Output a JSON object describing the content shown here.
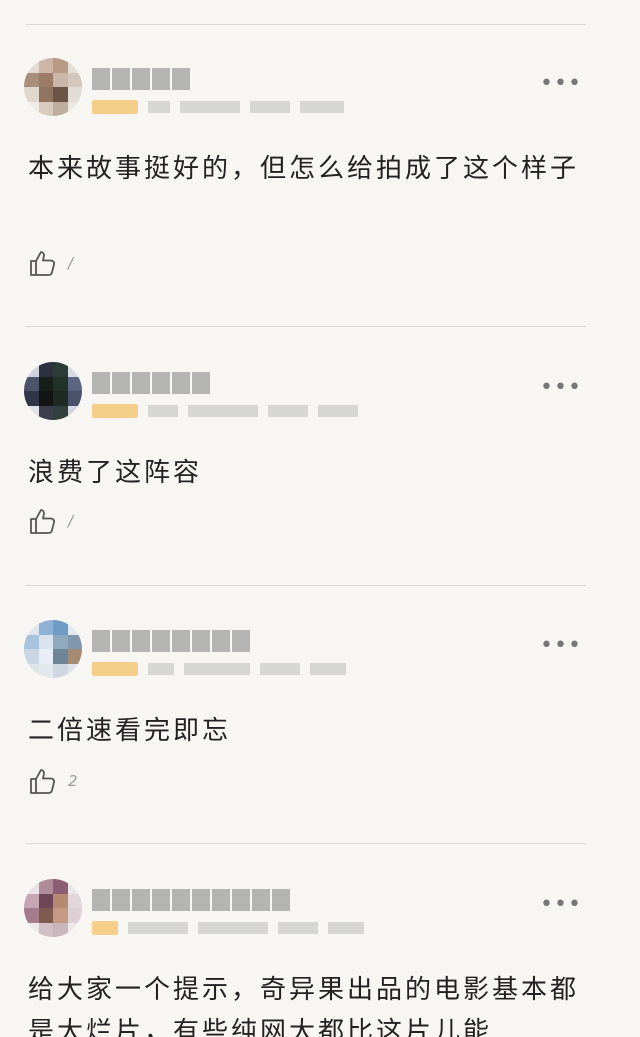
{
  "comments": [
    {
      "text": "本来故事挺好的，但怎么给拍成了这个样子",
      "likes": "/",
      "more_label": "•••",
      "avatar_colors": [
        "#e6dcd3",
        "#cdb6a6",
        "#b99a84",
        "#e4ded8",
        "#a78f7c",
        "#9d7b64",
        "#c9b7a9",
        "#d3c7bc",
        "#e0d7cf",
        "#8f7560",
        "#6b5445",
        "#e2dcd6",
        "#f0ece8",
        "#d9cbbd",
        "#bfae9f",
        "#ece7e2"
      ]
    },
    {
      "text": "浪费了这阵容",
      "likes": "/",
      "more_label": "•••",
      "avatar_colors": [
        "#cdd2dd",
        "#2b3140",
        "#2a3c33",
        "#d7dbe4",
        "#4b5468",
        "#172018",
        "#20322a",
        "#5d6680",
        "#2e3648",
        "#131515",
        "#1f2a24",
        "#49526a",
        "#dfe2e8",
        "#3a3f4d",
        "#31403a",
        "#d2d6de"
      ]
    },
    {
      "text": "二倍速看完即忘",
      "likes": "2",
      "more_label": "•••",
      "avatar_colors": [
        "#dfe6ee",
        "#8fb2d4",
        "#6f9cc6",
        "#e4e9ef",
        "#a8c3dd",
        "#d8e3ee",
        "#8fa9bf",
        "#7f98ad",
        "#c9d6e3",
        "#e8eef3",
        "#6e8499",
        "#a58a74",
        "#dee4ea",
        "#e3e8ee",
        "#cfd8e1",
        "#dde3e9"
      ]
    },
    {
      "text": "给大家一个提示，奇异果出品的电影基本都是大烂片，有些纯网大都比这片儿能",
      "likes": "",
      "more_label": "•••",
      "avatar_colors": [
        "#e9e2e4",
        "#b08b98",
        "#8d5e73",
        "#ece6e8",
        "#c7a6b3",
        "#6f4657",
        "#b48a73",
        "#e1d6da",
        "#a47c8c",
        "#7e5a4f",
        "#c49a84",
        "#dcd0d4",
        "#ede8ea",
        "#d2bfc6",
        "#cbb5bd",
        "#ede9eb"
      ]
    }
  ]
}
